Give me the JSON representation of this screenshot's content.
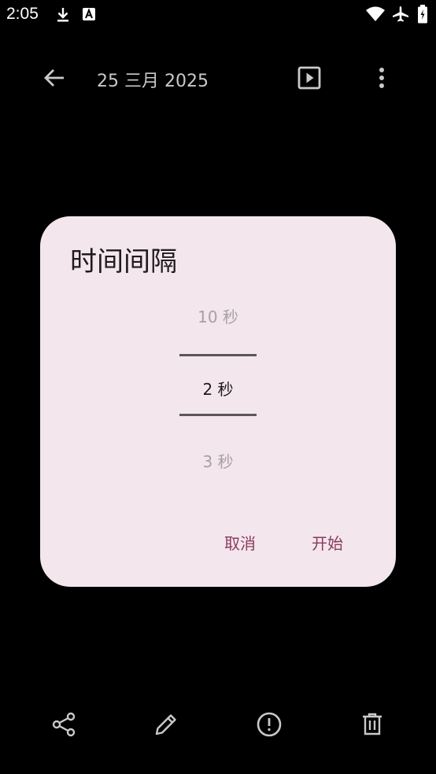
{
  "status_bar": {
    "time": "2:05",
    "icons": [
      "download-icon",
      "a-badge-icon",
      "wifi-icon",
      "airplane-icon",
      "battery-icon"
    ]
  },
  "app_bar": {
    "title": "25 三月 2025",
    "icons": [
      "back-arrow-icon",
      "slideshow-play-icon",
      "more-vert-icon"
    ]
  },
  "dialog": {
    "title": "时间间隔",
    "picker": {
      "previous": "10 秒",
      "selected": "2 秒",
      "next": "3 秒"
    },
    "cancel_label": "取消",
    "start_label": "开始"
  },
  "bottom_bar": {
    "icons": [
      "share-icon",
      "edit-pencil-icon",
      "info-alert-icon",
      "delete-trash-icon"
    ]
  },
  "colors": {
    "background": "#000000",
    "dialog_background": "#f3e6ec",
    "accent": "#8c3a5e",
    "icon": "#c9c9c9"
  }
}
